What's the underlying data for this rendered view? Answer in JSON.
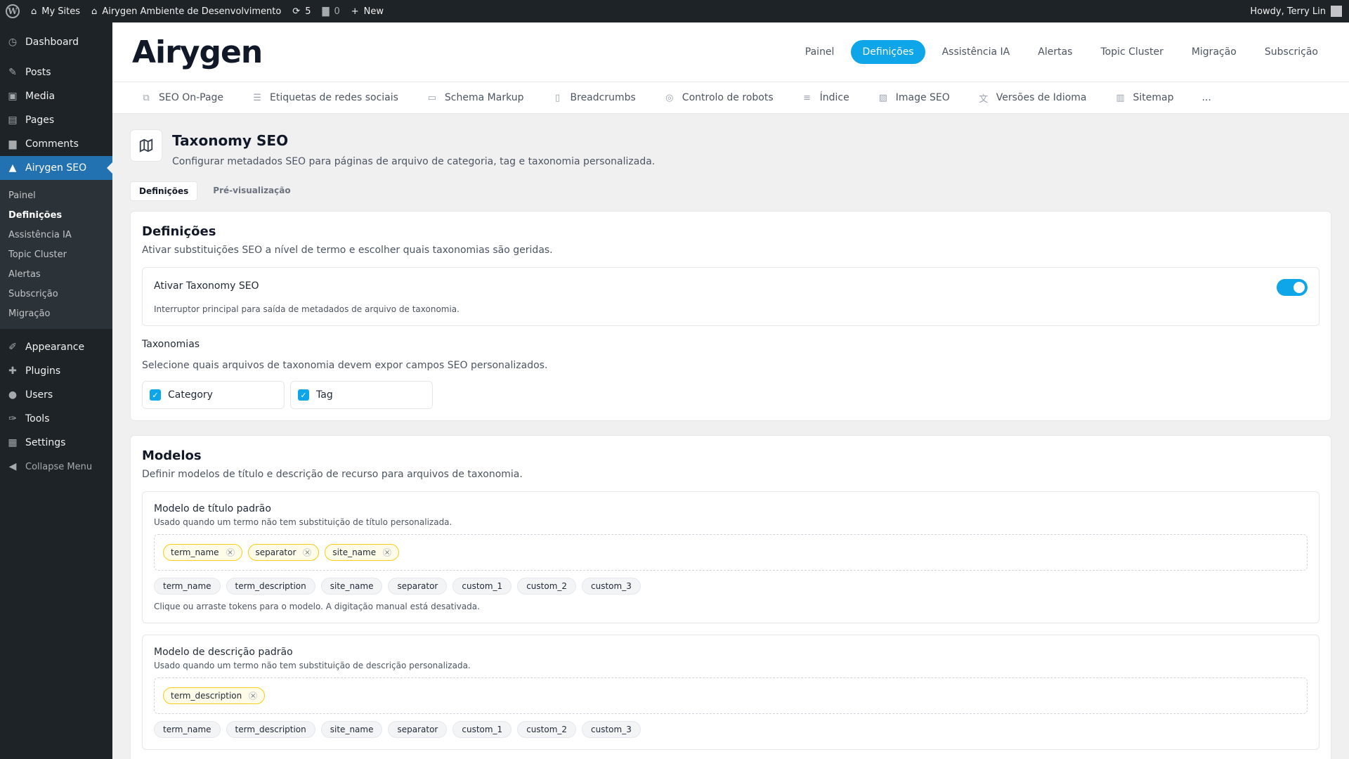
{
  "admin_bar": {
    "my_sites": "My Sites",
    "site_name": "Airygen Ambiente de Desenvolvimento",
    "updates_count": "5",
    "comments_count": "0",
    "new_label": "New",
    "howdy": "Howdy, Terry Lin"
  },
  "sidebar": {
    "items_top": [
      {
        "label": "Dashboard",
        "icon": "dashboard-icon"
      },
      {
        "label": "Posts",
        "icon": "pin-icon"
      },
      {
        "label": "Media",
        "icon": "media-icon"
      },
      {
        "label": "Pages",
        "icon": "pages-icon"
      },
      {
        "label": "Comments",
        "icon": "comment-icon"
      }
    ],
    "current": "Airygen SEO",
    "submenu": [
      "Painel",
      "Definições",
      "Assistência IA",
      "Topic Cluster",
      "Alertas",
      "Subscrição",
      "Migração"
    ],
    "items_bottom": [
      {
        "label": "Appearance",
        "icon": "brush-icon"
      },
      {
        "label": "Plugins",
        "icon": "plugin-icon"
      },
      {
        "label": "Users",
        "icon": "user-icon"
      },
      {
        "label": "Tools",
        "icon": "wrench-icon"
      },
      {
        "label": "Settings",
        "icon": "settings-icon"
      }
    ],
    "collapse": "Collapse Menu"
  },
  "brand": "Airygen",
  "top_nav": [
    "Painel",
    "Definições",
    "Assistência IA",
    "Alertas",
    "Topic Cluster",
    "Migração",
    "Subscrição"
  ],
  "top_nav_active": "Definições",
  "sub_nav": [
    {
      "label": "SEO On-Page",
      "icon": "copy-icon"
    },
    {
      "label": "Etiquetas de redes sociais",
      "icon": "list-icon"
    },
    {
      "label": "Schema Markup",
      "icon": "message-icon"
    },
    {
      "label": "Breadcrumbs",
      "icon": "file-icon"
    },
    {
      "label": "Controlo de robots",
      "icon": "robot-icon"
    },
    {
      "label": "Índice",
      "icon": "menu-icon"
    },
    {
      "label": "Image SEO",
      "icon": "image-icon"
    },
    {
      "label": "Versões de Idioma",
      "icon": "translate-icon"
    },
    {
      "label": "Sitemap",
      "icon": "map-icon"
    },
    {
      "label": "...",
      "icon": ""
    }
  ],
  "page": {
    "title": "Taxonomy SEO",
    "description": "Configurar metadados SEO para páginas de arquivo de categoria, tag e taxonomia personalizada.",
    "tabs": [
      "Definições",
      "Pré-visualização"
    ]
  },
  "settings_card": {
    "title": "Definições",
    "description": "Ativar substituições SEO a nível de termo e escolher quais taxonomias são geridas.",
    "toggle_label": "Ativar Taxonomy SEO",
    "toggle_help": "Interruptor principal para saída de metadados de arquivo de taxonomia.",
    "toggle_on": true,
    "taxonomies_label": "Taxonomias",
    "taxonomies_help": "Selecione quais arquivos de taxonomia devem expor campos SEO personalizados.",
    "taxonomies": [
      "Category",
      "Tag"
    ]
  },
  "templates_card": {
    "title": "Modelos",
    "description": "Definir modelos de título e descrição de recurso para arquivos de taxonomia.",
    "title_template": {
      "label": "Modelo de título padrão",
      "help": "Usado quando um termo não tem substituição de título personalizada.",
      "chips": [
        "term_name",
        "separator",
        "site_name"
      ],
      "tokens": [
        "term_name",
        "term_description",
        "site_name",
        "separator",
        "custom_1",
        "custom_2",
        "custom_3"
      ],
      "footer": "Clique ou arraste tokens para o modelo. A digitação manual está desativada."
    },
    "desc_template": {
      "label": "Modelo de descrição padrão",
      "help": "Usado quando um termo não tem substituição de descrição personalizada.",
      "chips": [
        "term_description"
      ],
      "tokens": [
        "term_name",
        "term_description",
        "site_name",
        "separator",
        "custom_1",
        "custom_2",
        "custom_3"
      ]
    }
  },
  "colors": {
    "accent": "#0ea5e9",
    "wp_blue": "#2271b1",
    "admin_dark": "#1d2327"
  }
}
